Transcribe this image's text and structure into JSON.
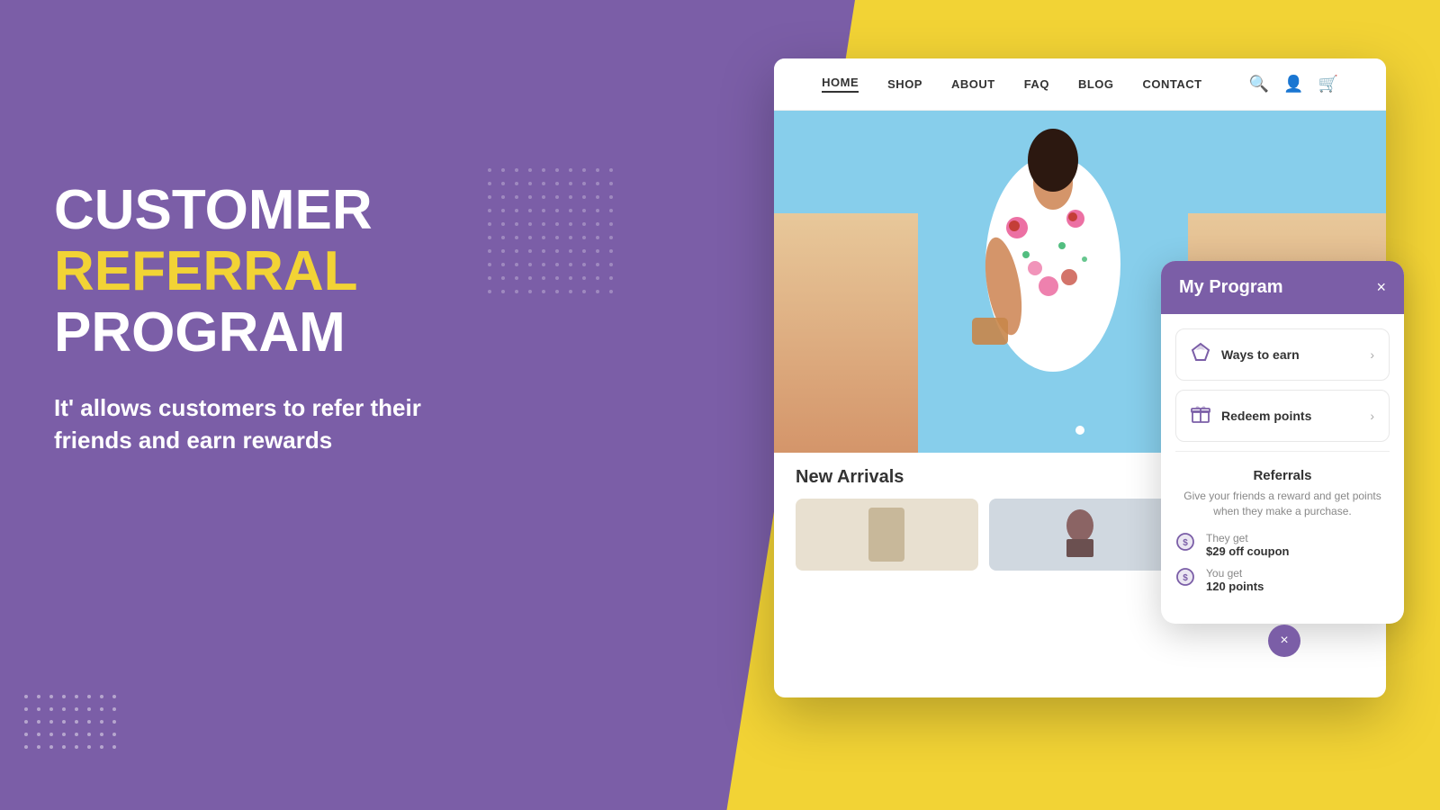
{
  "page": {
    "title": "Customer Referral Program"
  },
  "background": {
    "purple": "#7B5EA7",
    "yellow": "#F2D335"
  },
  "hero": {
    "headline_line1": "CUSTOMER",
    "headline_line2": "REFERRAL",
    "headline_line3": "PROGRAM",
    "description": "It' allows customers to refer their friends and earn rewards"
  },
  "nav": {
    "items": [
      {
        "label": "HOME",
        "active": true
      },
      {
        "label": "SHOP",
        "active": false
      },
      {
        "label": "ABOUT",
        "active": false
      },
      {
        "label": "FAQ",
        "active": false
      },
      {
        "label": "BLOG",
        "active": false
      },
      {
        "label": "CONTACT",
        "active": false
      }
    ]
  },
  "new_arrivals": {
    "title": "New Arrivals"
  },
  "my_program": {
    "title": "My Program",
    "close_label": "×",
    "ways_to_earn": "Ways to earn",
    "redeem_points": "Redeem points",
    "referrals_title": "Referrals",
    "referrals_desc": "Give your friends a reward and get points when they make a purchase.",
    "they_get_label": "They get",
    "they_get_value": "$29 off coupon",
    "you_get_label": "You get",
    "you_get_value": "120 points"
  },
  "floating_button": {
    "label": "×"
  }
}
